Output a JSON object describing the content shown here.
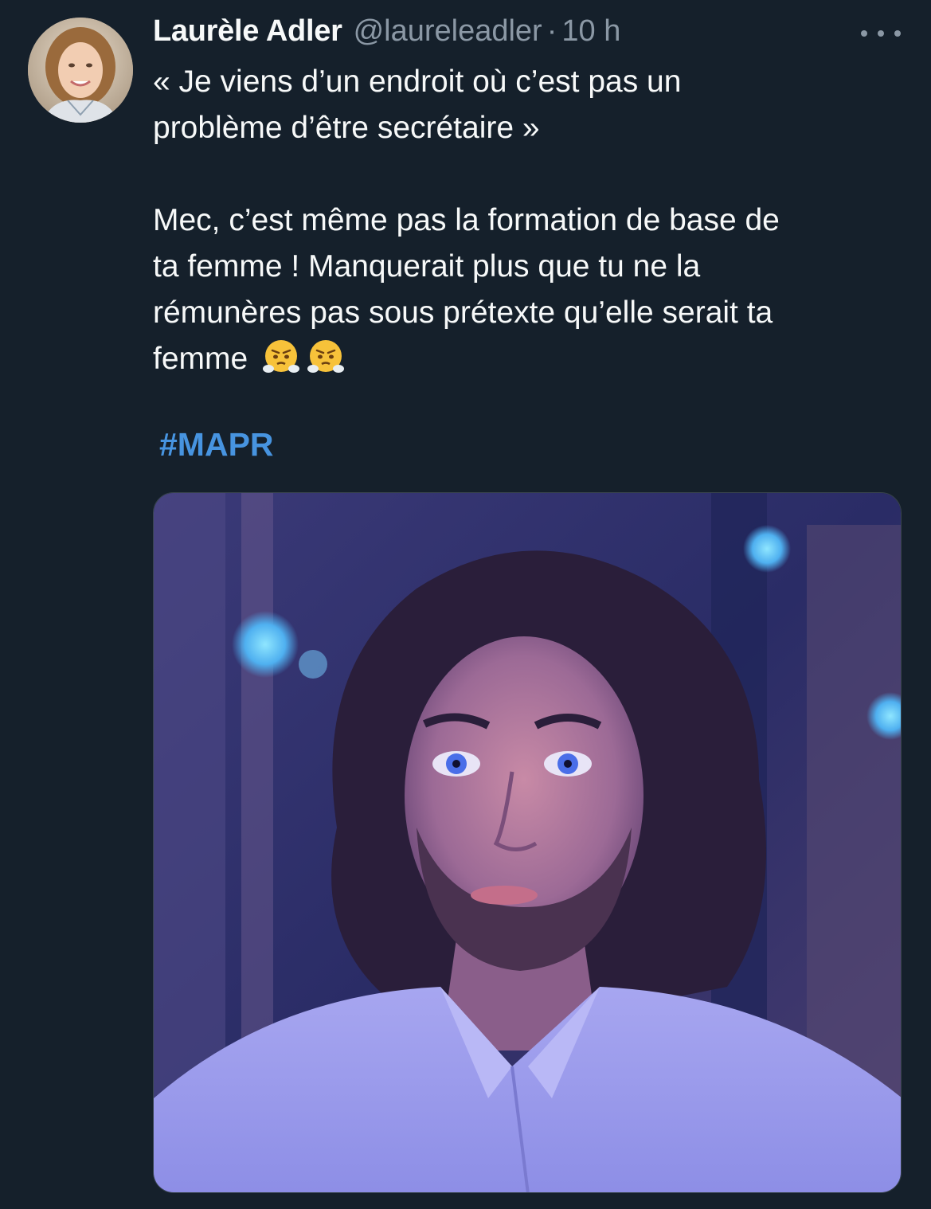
{
  "tweet": {
    "author_name": "Laurèle Adler",
    "handle": "@laureleadler",
    "separator": "·",
    "time": "10 h",
    "more_icon": "more-horizontal-icon",
    "text": {
      "line1": "« Je viens d’un endroit où c’est pas un",
      "line2": "problème d’être secrétaire »",
      "line3": "Mec, c’est même pas la formation de base de",
      "line4": "ta femme ! Manquerait plus que tu ne la",
      "line5": "rémunères pas sous prétexte qu’elle serait ta",
      "line6": "femme"
    },
    "emojis": [
      "face-with-steam-from-nose-emoji",
      "face-with-steam-from-nose-emoji"
    ],
    "hashtag": "#MAPR",
    "media": {
      "type": "photo",
      "subject": "man-with-long-dark-hair-photo"
    }
  },
  "colors": {
    "background": "#15202b",
    "primary_text": "#f7f9f9",
    "secondary_text": "#8b98a5",
    "link": "#4794e0"
  }
}
